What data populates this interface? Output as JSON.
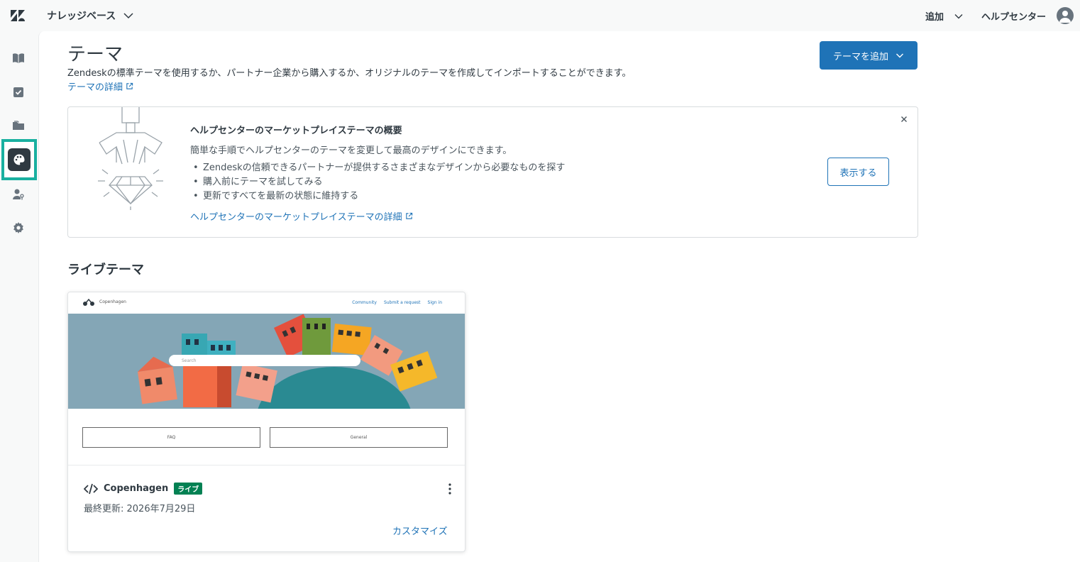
{
  "topbar": {
    "product": "ナレッジベース",
    "add_label": "追加",
    "help_center_label": "ヘルプセンター"
  },
  "sidebar": {
    "items": [
      {
        "icon": "book-icon"
      },
      {
        "icon": "checklist-icon"
      },
      {
        "icon": "folder-icon"
      },
      {
        "icon": "palette-icon",
        "active": true
      },
      {
        "icon": "user-key-icon"
      },
      {
        "icon": "gear-icon"
      }
    ]
  },
  "page": {
    "title": "テーマ",
    "description": "Zendeskの標準テーマを使用するか、パートナー企業から購入するか、オリジナルのテーマを作成してインポートすることができます。",
    "details_link": "テーマの詳細",
    "add_theme_button": "テーマを追加"
  },
  "marketplace": {
    "title": "ヘルプセンターのマーケットプレイステーマの概要",
    "subtitle": "簡単な手順でヘルプセンターのテーマを変更して最高のデザインにできます。",
    "bullets": [
      "Zendeskの信頼できるパートナーが提供するさまざまなデザインから必要なものを探す",
      "購入前にテーマを試してみる",
      "更新ですべてを最新の状態に維持する"
    ],
    "details_link": "ヘルプセンターのマーケットプレイステーマの詳細",
    "view_button": "表示する"
  },
  "live_section": {
    "title": "ライブテーマ"
  },
  "theme_card": {
    "preview": {
      "brand": "Copenhagen",
      "nav": [
        "Community",
        "Submit a request",
        "Sign in"
      ],
      "search_placeholder": "Search",
      "buttons": [
        "FAQ",
        "General"
      ]
    },
    "name": "Copenhagen",
    "badge": "ライブ",
    "updated": "最終更新: 2026年7月29日",
    "customize": "カスタマイズ"
  },
  "colors": {
    "accent": "#1f73b7",
    "active_nav_border": "#19b0a0",
    "live_badge": "#038153"
  }
}
